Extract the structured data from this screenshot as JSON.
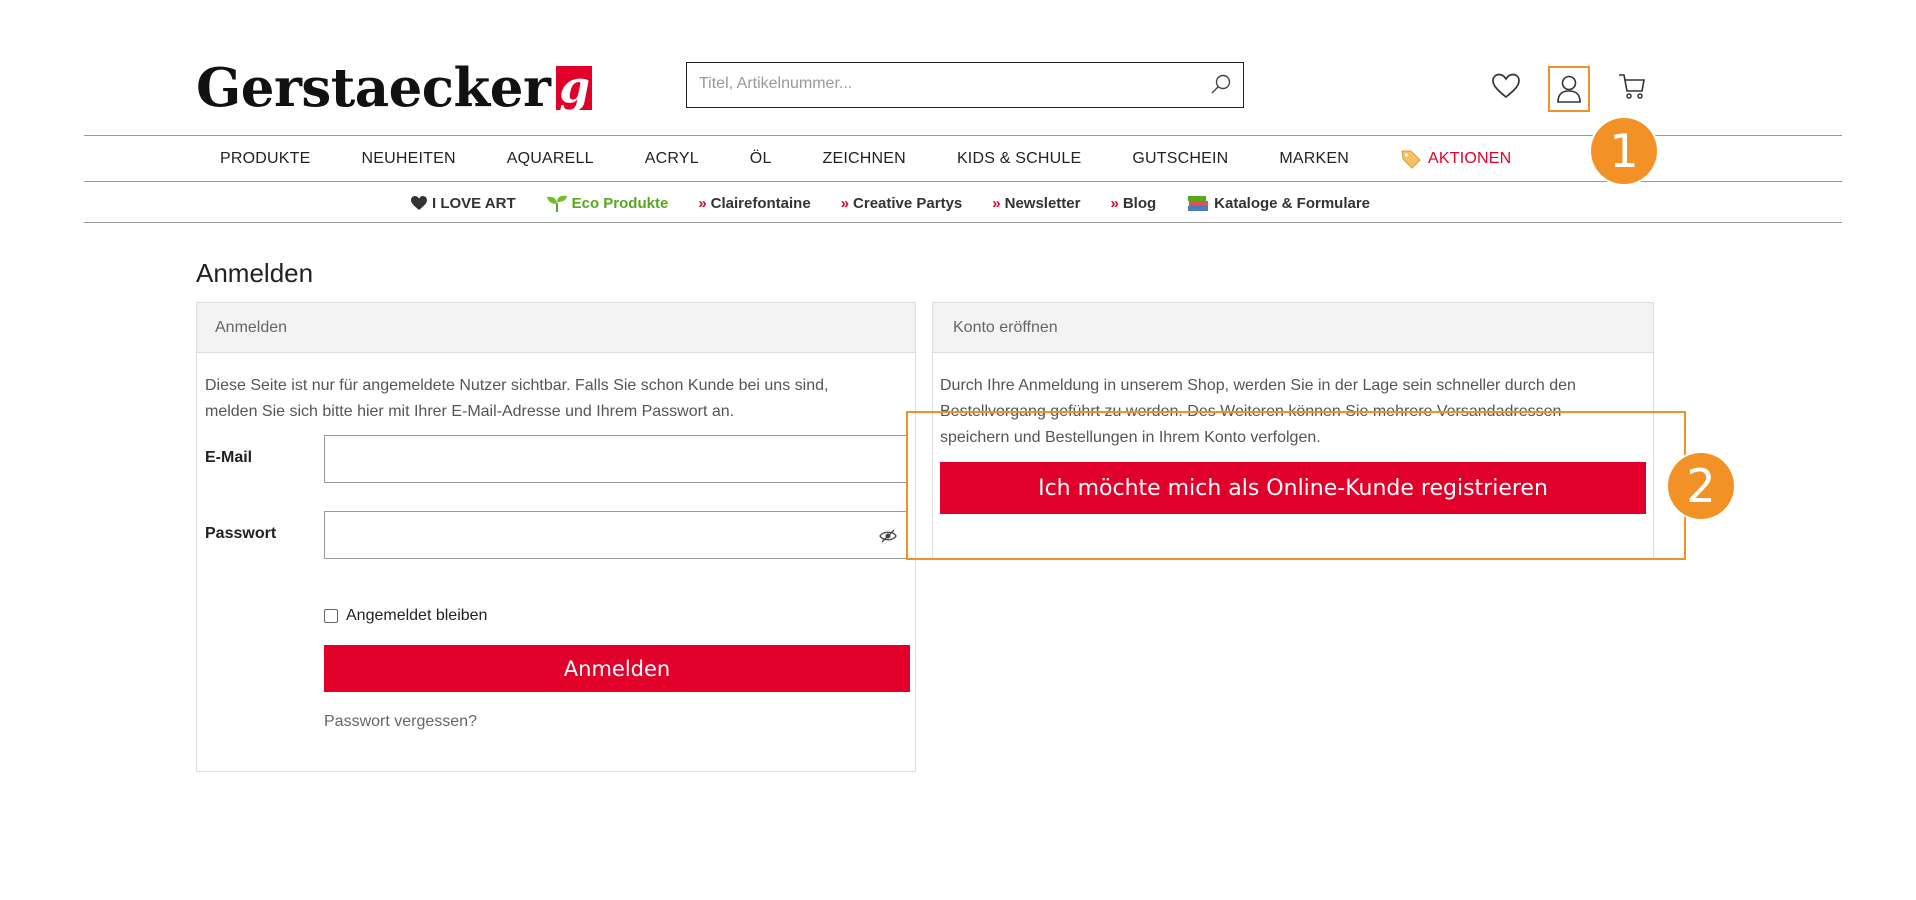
{
  "header": {
    "logo_text": "Gerstaecker",
    "logo_mark": "g",
    "search_placeholder": "Titel, Artikelnummer..."
  },
  "nav": {
    "main": [
      "PRODUKTE",
      "NEUHEITEN",
      "AQUARELL",
      "ACRYL",
      "ÖL",
      "ZEICHNEN",
      "KIDS & SCHULE",
      "GUTSCHEIN",
      "MARKEN"
    ],
    "aktionen": "AKTIONEN",
    "secondary": {
      "ilove": "I LOVE ART",
      "eco": "Eco Produkte",
      "clairefontaine": "Clairefontaine",
      "partys": "Creative Partys",
      "newsletter": "Newsletter",
      "blog": "Blog",
      "kataloge": "Kataloge & Formulare",
      "marker": "»"
    }
  },
  "page": {
    "title": "Anmelden"
  },
  "login": {
    "heading": "Anmelden",
    "intro_line1": "Diese Seite ist nur für angemeldete Nutzer sichtbar. Falls Sie schon Kunde bei uns sind,",
    "intro_line2": "melden Sie sich bitte hier mit Ihrer E-Mail-Adresse und Ihrem Passwort an.",
    "email_label": "E-Mail",
    "email_value": "",
    "password_label": "Passwort",
    "password_value": "",
    "remember_label": "Angemeldet bleiben",
    "submit_label": "Anmelden",
    "forgot_label": "Passwort vergessen?"
  },
  "register": {
    "heading": "Konto eröffnen",
    "text_line1": "Durch Ihre Anmeldung in unserem Shop, werden Sie in der Lage sein schneller durch den",
    "text_line2": "Bestellvorgang geführt zu werden. Des Weiteren können Sie mehrere Versandadressen",
    "text_line3": "speichern und Bestellungen in Ihrem Konto verfolgen.",
    "button_label": "Ich möchte mich als Online-Kunde registrieren"
  },
  "annotations": {
    "step1": "1",
    "step2": "2",
    "highlight_color": "#f29226"
  },
  "colors": {
    "brand_red": "#e0002a",
    "eco_green": "#5aa61e"
  }
}
